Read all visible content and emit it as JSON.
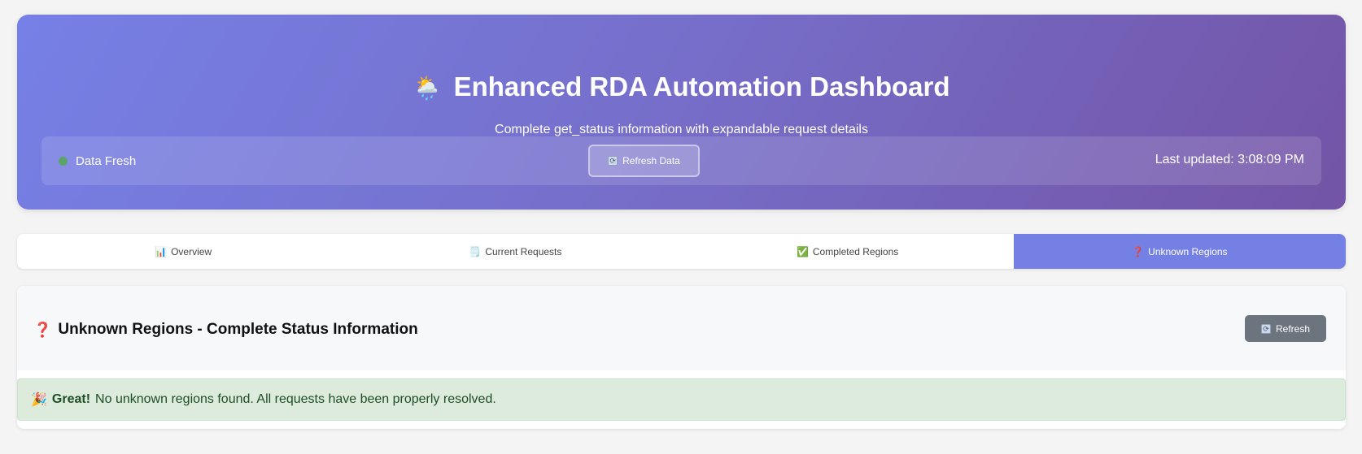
{
  "header": {
    "title_emoji": "🌦️",
    "title": "Enhanced RDA Automation Dashboard",
    "subtitle": "Complete get_status information with expandable request details",
    "status_text": "Data Fresh",
    "status_color": "#5aa469",
    "refresh_label": "Refresh Data",
    "last_updated": "Last updated: 3:08:09 PM"
  },
  "tabs": [
    {
      "icon": "📊",
      "label": "Overview"
    },
    {
      "icon": "🗒️",
      "label": "Current Requests"
    },
    {
      "icon": "✅",
      "label": "Completed Regions"
    },
    {
      "icon": "❓",
      "label": "Unknown Regions",
      "active": true
    }
  ],
  "panel": {
    "title": "Unknown Regions - Complete Status Information",
    "refresh_label": "Refresh",
    "alert_icon": "🎉",
    "alert_strong": "Great!",
    "alert_text": "No unknown regions found. All requests have been properly resolved."
  },
  "colors": {
    "accent": "#7580e4",
    "header_start": "#7680e6",
    "header_end": "#7354a6",
    "success_bg": "#dcebdc",
    "refresh_button": "#6c757d"
  }
}
